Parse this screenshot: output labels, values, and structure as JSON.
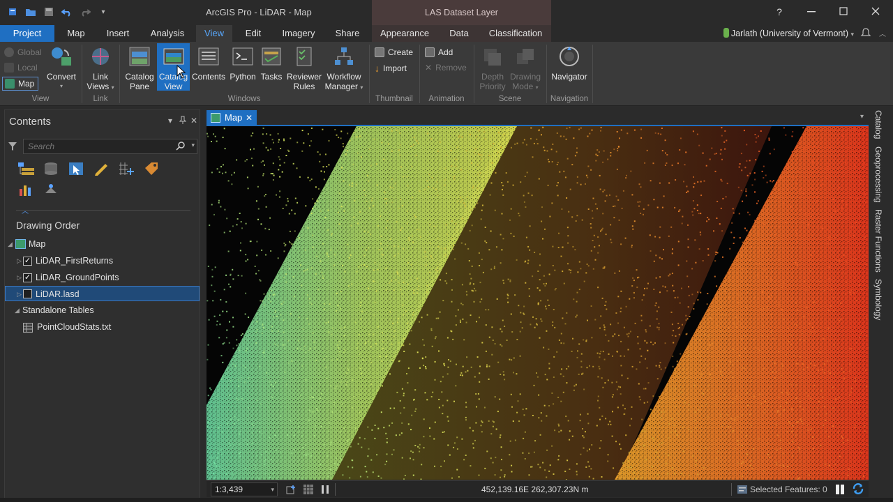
{
  "window": {
    "title": "ArcGIS Pro - LiDAR - Map",
    "context_title": "LAS Dataset Layer"
  },
  "tabs": {
    "project": "Project",
    "items": [
      "Map",
      "Insert",
      "Analysis",
      "View",
      "Edit",
      "Imagery",
      "Share"
    ],
    "context_items": [
      "Appearance",
      "Data",
      "Classification"
    ],
    "active": "View"
  },
  "user": {
    "name": "Jarlath (University of Vermont)"
  },
  "ribbon": {
    "view_group": {
      "global": "Global",
      "local": "Local",
      "map": "Map",
      "convert": "Convert",
      "label": "View"
    },
    "link_group": {
      "link_views_1": "Link",
      "link_views_2": "Views",
      "label": "Link"
    },
    "windows_group": {
      "catalog_pane_1": "Catalog",
      "catalog_pane_2": "Pane",
      "catalog_view_1": "Catalog",
      "catalog_view_2": "View",
      "contents": "Contents",
      "python": "Python",
      "tasks": "Tasks",
      "reviewer_1": "Reviewer",
      "reviewer_2": "Rules",
      "workflow_1": "Workflow",
      "workflow_2": "Manager",
      "label": "Windows"
    },
    "thumbnail_group": {
      "create": "Create",
      "import": "Import",
      "label": "Thumbnail"
    },
    "animation_group": {
      "add": "Add",
      "remove": "Remove",
      "label": "Animation"
    },
    "scene_group": {
      "depth_1": "Depth",
      "depth_2": "Priority",
      "drawing_1": "Drawing",
      "drawing_2": "Mode",
      "label": "Scene"
    },
    "navigation_group": {
      "navigator": "Navigator",
      "label": "Navigation"
    }
  },
  "contents": {
    "title": "Contents",
    "search_placeholder": "Search",
    "drawing_order": "Drawing Order",
    "map_item": "Map",
    "layers": [
      {
        "name": "LiDAR_FirstReturns",
        "checked": true
      },
      {
        "name": "LiDAR_GroundPoints",
        "checked": true
      },
      {
        "name": "LiDAR.lasd",
        "checked": false
      }
    ],
    "standalone_tables": "Standalone Tables",
    "table": "PointCloudStats.txt"
  },
  "map_view": {
    "tab_label": "Map",
    "scale": "1:3,439",
    "coordinates": "452,139.16E 262,307.23N m",
    "selected_features": "Selected Features: 0"
  },
  "right_dock": [
    "Catalog",
    "Geoprocessing",
    "Raster Functions",
    "Symbology"
  ],
  "colors": {
    "accent": "#1f6fc2",
    "context_band": "#4a3b3b",
    "ribbon_bg": "#3a3a3a",
    "selection": "#204a78"
  }
}
